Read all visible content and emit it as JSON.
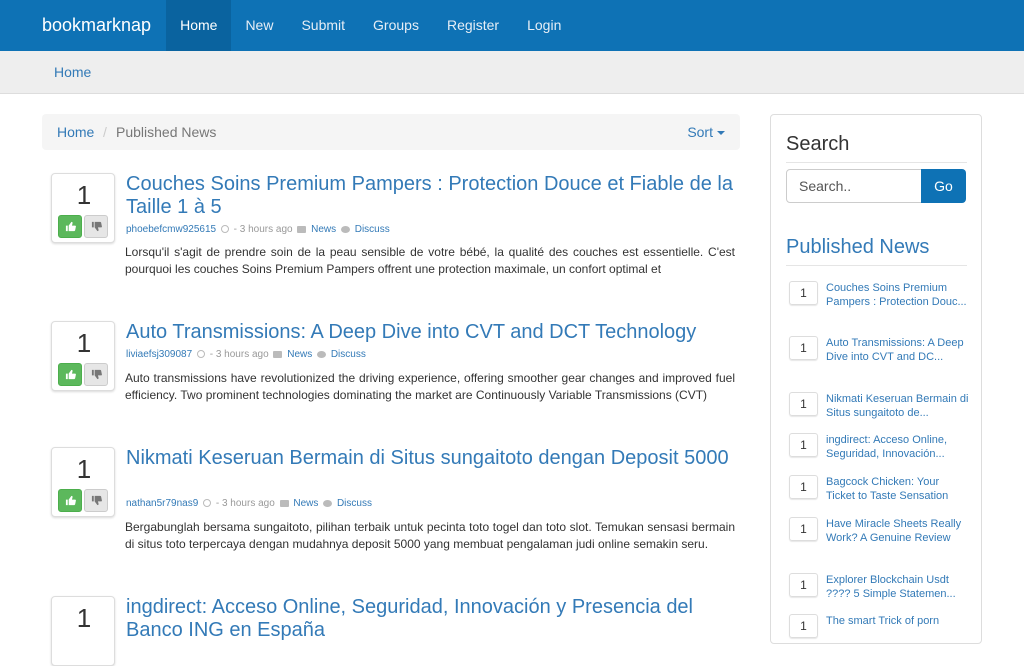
{
  "navbar": {
    "brand": "bookmarknap",
    "items": [
      "Home",
      "New",
      "Submit",
      "Groups",
      "Register",
      "Login"
    ]
  },
  "subbar": {
    "home": "Home"
  },
  "breadcrumb": {
    "home": "Home",
    "separator": "/",
    "current": "Published News",
    "sort": "Sort"
  },
  "stories": [
    {
      "votes": "1",
      "title": "Couches Soins Premium Pampers : Protection Douce et Fiable de la Taille 1 à 5",
      "user": "phoebefcmw925615",
      "time": "- 3 hours ago",
      "category": "News",
      "discuss": "Discuss",
      "desc": "Lorsqu'il s'agit de prendre soin de la peau sensible de votre bébé, la qualité des couches est essentielle. C'est pourquoi les couches Soins Premium Pampers offrent une protection maximale, un confort optimal et"
    },
    {
      "votes": "1",
      "title": "Auto Transmissions: A Deep Dive into CVT and DCT Technology",
      "user": "liviaefsj309087",
      "time": "- 3 hours ago",
      "category": "News",
      "discuss": "Discuss",
      "desc": "Auto transmissions have revolutionized the driving experience, offering smoother gear changes and improved fuel efficiency. Two prominent technologies dominating the market are Continuously Variable Transmissions (CVT)"
    },
    {
      "votes": "1",
      "title": "Nikmati Keseruan Bermain di Situs sungaitoto dengan Deposit 5000",
      "user": "nathan5r79nas9",
      "time": "- 3 hours ago",
      "category": "News",
      "discuss": "Discuss",
      "desc": "Bergabunglah bersama sungaitoto, pilihan terbaik untuk pecinta toto togel dan toto slot. Temukan sensasi bermain di situs toto terpercaya dengan mudahnya deposit 5000 yang membuat pengalaman judi online semakin seru."
    },
    {
      "votes": "1",
      "title": "ingdirect: Acceso Online, Seguridad, Innovación y Presencia del Banco ING en España",
      "user": "",
      "time": "",
      "category": "",
      "discuss": "",
      "desc": ""
    }
  ],
  "sidebar": {
    "search_title": "Search",
    "search_placeholder": "Search..",
    "go": "Go",
    "published_title": "Published News",
    "items": [
      {
        "n": "1",
        "text": "Couches Soins Premium Pampers : Protection Douc..."
      },
      {
        "n": "1",
        "text": "Auto Transmissions: A Deep Dive into CVT and DC..."
      },
      {
        "n": "1",
        "text": "Nikmati Keseruan Bermain di Situs sungaitoto de..."
      },
      {
        "n": "1",
        "text": "ingdirect: Acceso Online, Seguridad, Innovación..."
      },
      {
        "n": "1",
        "text": "Bagcock Chicken: Your Ticket to Taste Sensation"
      },
      {
        "n": "1",
        "text": "Have Miracle Sheets Really Work? A Genuine Review"
      },
      {
        "n": "1",
        "text": "Explorer Blockchain Usdt ???? 5 Simple Statemen..."
      },
      {
        "n": "1",
        "text": "The smart Trick of porn"
      }
    ]
  },
  "colors": {
    "navbar": "#0e72b5",
    "link": "#337ab7",
    "upvote": "#5cb85c"
  }
}
